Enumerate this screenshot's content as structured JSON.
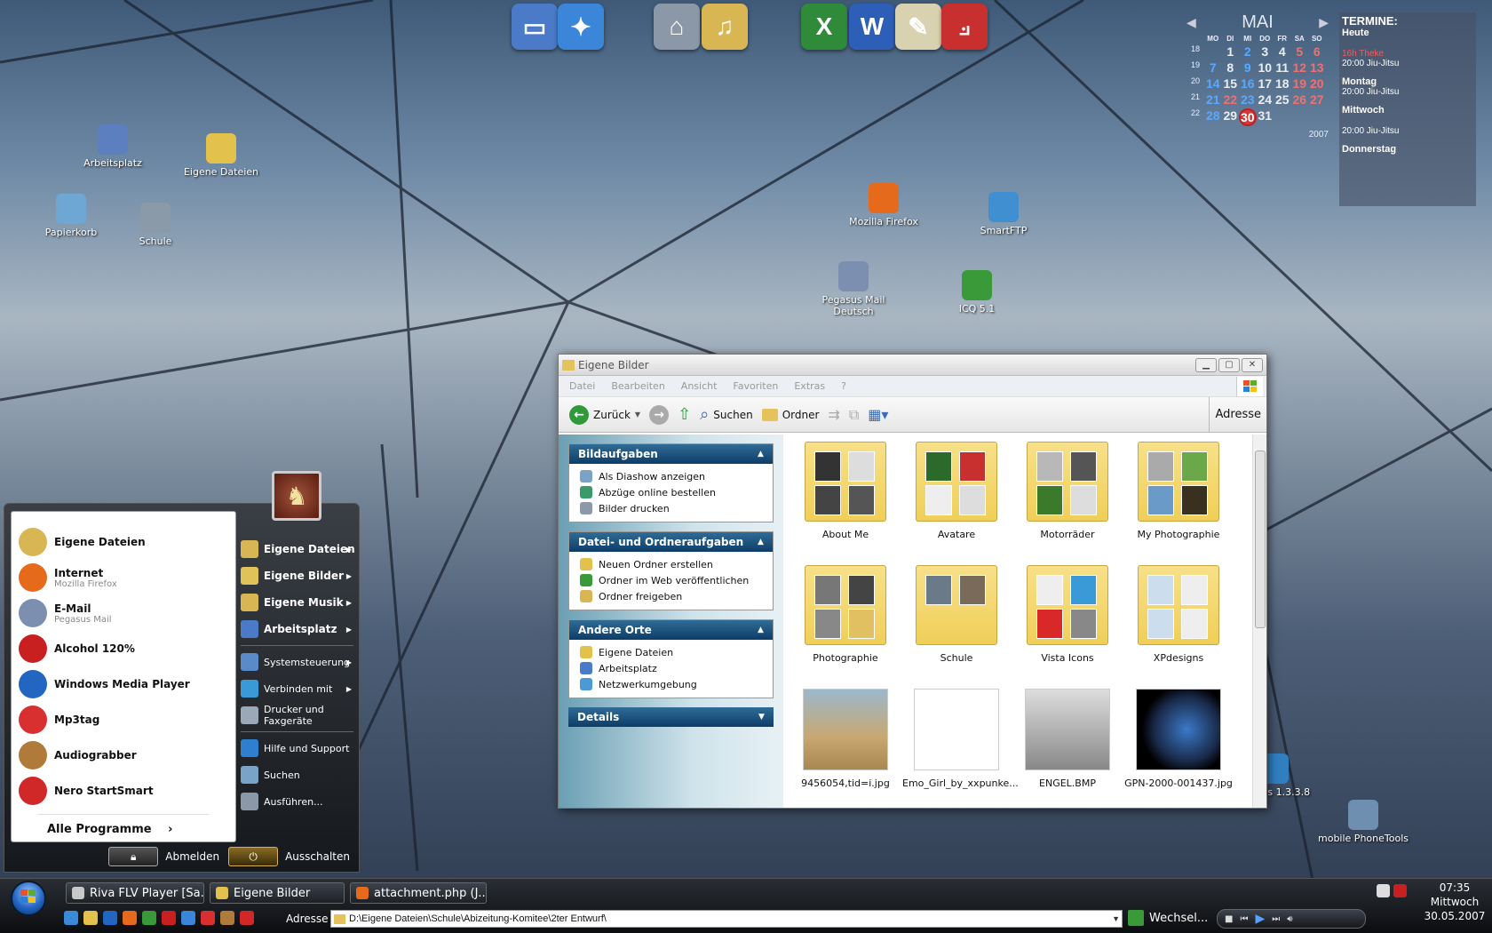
{
  "desktop": {
    "icons": [
      {
        "label": "Arbeitsplatz",
        "icon": "computer-icon",
        "color": "#5c7fbf"
      },
      {
        "label": "Eigene Dateien",
        "icon": "folder-icon",
        "color": "#e3c14d"
      },
      {
        "label": "Papierkorb",
        "icon": "recycle-bin-icon",
        "color": "#6fa7d4"
      },
      {
        "label": "Schule",
        "icon": "network-drive-icon",
        "color": "#8a9aa8"
      },
      {
        "label": "Mozilla Firefox",
        "icon": "firefox-icon",
        "color": "#e66a1c"
      },
      {
        "label": "SmartFTP",
        "icon": "smartftp-icon",
        "color": "#3f8fd1"
      },
      {
        "label": "Pegasus Mail Deutsch",
        "icon": "pegasus-icon",
        "color": "#7d8fb0"
      },
      {
        "label": "ICQ 5.1",
        "icon": "icq-flower-icon",
        "color": "#3a9a3a"
      },
      {
        "label": "Scribus 1.3.3.8",
        "icon": "scribus-icon",
        "color": "#2f7fc1"
      },
      {
        "label": "mobile PhoneTools",
        "icon": "phone-tools-icon",
        "color": "#6f8fb0"
      }
    ],
    "dock": [
      {
        "icon": "monitor-icon",
        "color": "#4a7ac8",
        "glyph": "▭"
      },
      {
        "icon": "safari-compass-icon",
        "color": "#3b86d8",
        "glyph": "✦"
      },
      {
        "icon": "network-drive-icon",
        "color": "#8a98a8",
        "glyph": "⌂"
      },
      {
        "icon": "music-folder-icon",
        "color": "#d8b654",
        "glyph": "♫"
      },
      {
        "icon": "excel-icon",
        "color": "#2f8b3a",
        "glyph": "X"
      },
      {
        "icon": "word-icon",
        "color": "#2e5fb8",
        "glyph": "W"
      },
      {
        "icon": "notepad-icon",
        "color": "#d8d2b0",
        "glyph": "✎"
      },
      {
        "icon": "acrobat-icon",
        "color": "#c83030",
        "glyph": "⟓"
      }
    ]
  },
  "calendar": {
    "month": "MAI",
    "year": "2007",
    "weekdays": [
      "MO",
      "DI",
      "MI",
      "DO",
      "FR",
      "SA",
      "SO"
    ],
    "weeks": [
      {
        "wk": "18",
        "days": [
          "",
          "1",
          "2",
          "3",
          "4",
          "5",
          "6"
        ]
      },
      {
        "wk": "19",
        "days": [
          "7",
          "8",
          "9",
          "10",
          "11",
          "12",
          "13"
        ]
      },
      {
        "wk": "20",
        "days": [
          "14",
          "15",
          "16",
          "17",
          "18",
          "19",
          "20"
        ]
      },
      {
        "wk": "21",
        "days": [
          "21",
          "22",
          "23",
          "24",
          "25",
          "26",
          "27"
        ]
      },
      {
        "wk": "22",
        "days": [
          "28",
          "29",
          "30",
          "31",
          "",
          "",
          ""
        ]
      }
    ],
    "today": "30"
  },
  "termine": {
    "title": "TERMINE:",
    "heute": "Heute",
    "heute_red": "16h Theke",
    "heute_ev": "20:00 Jiu-Jitsu",
    "montag": "Montag",
    "montag_ev": "20:00 Jiu-Jitsu",
    "mittwoch": "Mittwoch",
    "mittwoch_ev": "20:00 Jiu-Jitsu",
    "donnerstag": "Donnerstag"
  },
  "explorer": {
    "title": "Eigene Bilder",
    "menu": [
      "Datei",
      "Bearbeiten",
      "Ansicht",
      "Favoriten",
      "Extras",
      "?"
    ],
    "toolbar": {
      "back": "Zurück",
      "search": "Suchen",
      "folders": "Ordner",
      "address": "Adresse"
    },
    "panes": [
      {
        "title": "Bildaufgaben",
        "items": [
          {
            "label": "Als Diashow anzeigen",
            "color": "#7aa3c8"
          },
          {
            "label": "Abzüge online bestellen",
            "color": "#3a9a6a"
          },
          {
            "label": "Bilder drucken",
            "color": "#8b99aa"
          }
        ]
      },
      {
        "title": "Datei- und Ordneraufgaben",
        "items": [
          {
            "label": "Neuen Ordner erstellen",
            "color": "#e3c14d"
          },
          {
            "label": "Ordner im Web veröffentlichen",
            "color": "#3a9a3a"
          },
          {
            "label": "Ordner freigeben",
            "color": "#d8b654"
          }
        ]
      },
      {
        "title": "Andere Orte",
        "items": [
          {
            "label": "Eigene Dateien",
            "color": "#e3c14d"
          },
          {
            "label": "Arbeitsplatz",
            "color": "#4a7ac8"
          },
          {
            "label": "Netzwerkumgebung",
            "color": "#4a9ad8"
          }
        ]
      },
      {
        "title": "Details",
        "items": []
      }
    ],
    "items": [
      {
        "label": "About Me",
        "kind": "folder"
      },
      {
        "label": "Avatare",
        "kind": "folder"
      },
      {
        "label": "Motorräder",
        "kind": "folder"
      },
      {
        "label": "My Photographie",
        "kind": "folder"
      },
      {
        "label": "Photographie",
        "kind": "folder"
      },
      {
        "label": "Schule",
        "kind": "folder"
      },
      {
        "label": "Vista Icons",
        "kind": "folder"
      },
      {
        "label": "XPdesigns",
        "kind": "folder"
      },
      {
        "label": "9456054,tid=i.jpg",
        "kind": "photo"
      },
      {
        "label": "Emo_Girl_by_xxpunke...",
        "kind": "photo"
      },
      {
        "label": "ENGEL.BMP",
        "kind": "photo"
      },
      {
        "label": "GPN-2000-001437.jpg",
        "kind": "photo"
      }
    ]
  },
  "startmenu": {
    "left": [
      {
        "label": "Eigene Dateien",
        "sub": "",
        "color": "#d8b654",
        "icon": "folder-icon"
      },
      {
        "label": "Internet",
        "sub": "Mozilla Firefox",
        "color": "#e66a1c",
        "icon": "firefox-icon"
      },
      {
        "label": "E-Mail",
        "sub": "Pegasus Mail",
        "color": "#7d8fb0",
        "icon": "pegasus-icon"
      },
      {
        "label": "Alcohol 120%",
        "sub": "",
        "color": "#c82020",
        "icon": "alcohol-icon"
      },
      {
        "label": "Windows Media Player",
        "sub": "",
        "color": "#2266c2",
        "icon": "media-player-icon"
      },
      {
        "label": "Mp3tag",
        "sub": "",
        "color": "#d83030",
        "icon": "mp3tag-icon"
      },
      {
        "label": "Audiograbber",
        "sub": "",
        "color": "#b07a3a",
        "icon": "audiograbber-icon"
      },
      {
        "label": "Nero StartSmart",
        "sub": "",
        "color": "#d02828",
        "icon": "nero-icon"
      }
    ],
    "all_programs": "Alle Programme",
    "right": [
      {
        "label": "Eigene Dateien",
        "bold": true,
        "arrow": true,
        "color": "#d8b654"
      },
      {
        "label": "Eigene Bilder",
        "bold": true,
        "arrow": true,
        "color": "#e0c25a"
      },
      {
        "label": "Eigene Musik",
        "bold": true,
        "arrow": true,
        "color": "#d8b654"
      },
      {
        "label": "Arbeitsplatz",
        "bold": true,
        "arrow": true,
        "color": "#4a7ac8"
      },
      {
        "label": "Systemsteuerung",
        "bold": false,
        "arrow": true,
        "color": "#5a8ac8"
      },
      {
        "label": "Verbinden mit",
        "bold": false,
        "arrow": true,
        "color": "#3a9ad8"
      },
      {
        "label": "Drucker und Faxgeräte",
        "bold": false,
        "arrow": false,
        "color": "#9aa8b8"
      },
      {
        "label": "Hilfe und Support",
        "bold": false,
        "arrow": false,
        "color": "#2f7fd1"
      },
      {
        "label": "Suchen",
        "bold": false,
        "arrow": false,
        "color": "#7aa3c8"
      },
      {
        "label": "Ausführen...",
        "bold": false,
        "arrow": false,
        "color": "#8a98a8"
      }
    ],
    "logoff": "Abmelden",
    "shutdown": "Ausschalten"
  },
  "taskbar": {
    "tasks": [
      {
        "label": "Riva FLV Player [Sa...",
        "color": "#c8c8c8"
      },
      {
        "label": "Eigene Bilder",
        "color": "#e3c14d"
      },
      {
        "label": "attachment.php (J...",
        "color": "#e66a1c"
      }
    ],
    "quicklaunch": [
      "#3a8ad8",
      "#e3c14d",
      "#2266c2",
      "#e66a1c",
      "#3a9a3a",
      "#c82020",
      "#3b86d8",
      "#d83030",
      "#b07a3a",
      "#d02828"
    ],
    "address_label": "Adresse",
    "address_value": "D:\\Eigene Dateien\\Schule\\Abizeitung-Komitee\\2ter Entwurf\\",
    "wechsel": "Wechsel...",
    "time": "07:35",
    "day": "Mittwoch",
    "date": "30.05.2007"
  }
}
